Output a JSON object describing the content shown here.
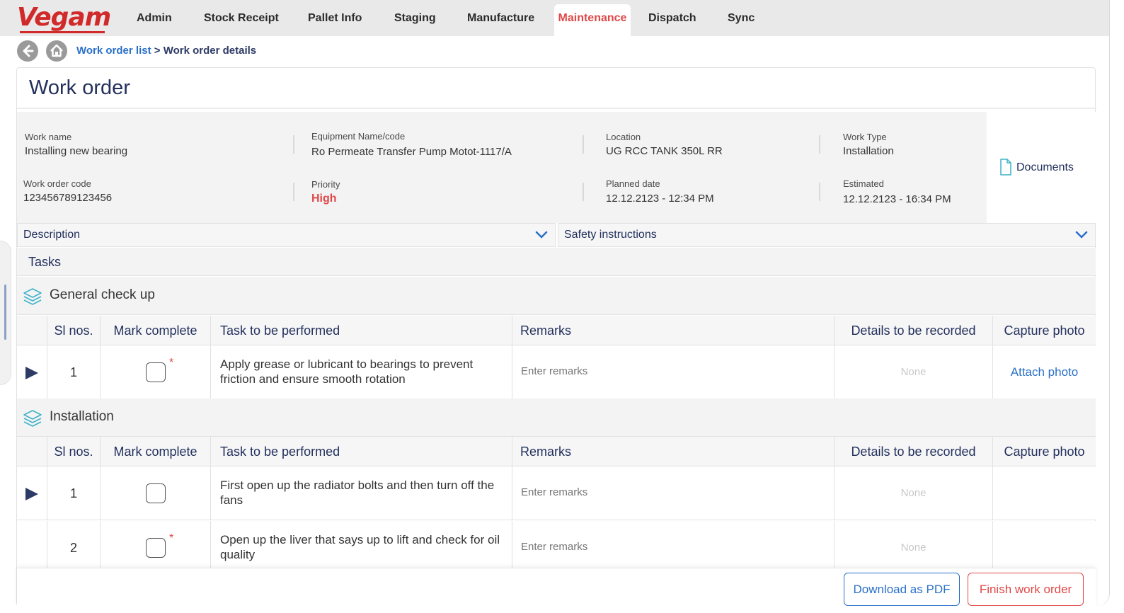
{
  "logo": "Vegam",
  "nav": [
    "Admin",
    "Stock Receipt",
    "Pallet Info",
    "Staging",
    "Manufacture",
    "Maintenance",
    "Dispatch",
    "Sync"
  ],
  "nav_active": "Maintenance",
  "breadcrumb": {
    "link": "Work order list",
    "sep": ">",
    "current": "Work order details"
  },
  "page_title": "Work order",
  "info": {
    "work_name_label": "Work name",
    "work_name": "Installing new bearing",
    "equipment_label": "Equipment Name/code",
    "equipment": "Ro Permeate Transfer Pump Motot-1117/A",
    "location_label": "Location",
    "location": "UG RCC TANK 350L RR",
    "work_type_label": "Work Type",
    "work_type": "Installation",
    "code_label": "Work order code",
    "code": "123456789123456",
    "priority_label": "Priority",
    "priority": "High",
    "planned_label": "Planned date",
    "planned": "12.12.2123 - 12:34 PM",
    "estimated_label": "Estimated",
    "estimated": "12.12.2123 - 16:34 PM"
  },
  "documents": "Documents",
  "accordions": {
    "description": "Description",
    "safety": "Safety instructions"
  },
  "tasks_title": "Tasks",
  "columns": {
    "sl": "Sl nos.",
    "mark": "Mark complete",
    "task": "Task to be performed",
    "remarks": "Remarks",
    "details": "Details to be recorded",
    "photo": "Capture photo"
  },
  "groups": [
    {
      "name": "General check up",
      "rows": [
        {
          "sl": "1",
          "task": "Apply grease or lubricant to bearings to prevent friction and ensure smooth rotation",
          "remarks_placeholder": "Enter remarks",
          "details": "None",
          "photo": "Attach photo",
          "required": "*"
        }
      ]
    },
    {
      "name": "Installation",
      "rows": [
        {
          "sl": "1",
          "task": "First open up the radiator bolts and then turn off the fans",
          "remarks_placeholder": "Enter remarks",
          "details": "None",
          "photo": "",
          "required": ""
        },
        {
          "sl": "2",
          "task": "Open up the liver that says up to lift and check for oil quality",
          "remarks_placeholder": "Enter remarks",
          "details": "None",
          "photo": "",
          "required": "*"
        }
      ]
    }
  ],
  "buttons": {
    "pdf": "Download as PDF",
    "finish": "Finish work order"
  },
  "colors": {
    "brand": "#d12a2a",
    "accent": "#2a70c8",
    "danger": "#e04848",
    "navy": "#23305c"
  }
}
